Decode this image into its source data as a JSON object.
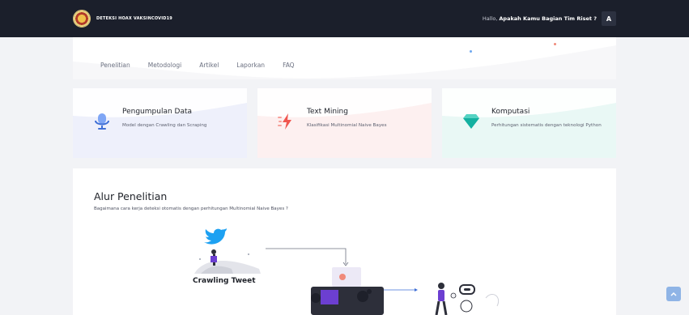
{
  "header": {
    "brand": "DETEKSI HOAX VAKSINCOVID19",
    "greeting": "Hallo,",
    "greeting_name": "Apakah Kamu Bagian Tim Riset ?",
    "avatar_initial": "A"
  },
  "nav": {
    "items": [
      {
        "label": "Penelitian"
      },
      {
        "label": "Metodologi"
      },
      {
        "label": "Artikel"
      },
      {
        "label": "Laporkan"
      },
      {
        "label": "FAQ"
      }
    ]
  },
  "cards": [
    {
      "title": "Pengumpulan Data",
      "desc": "Model dengan Crawling dan Scraping",
      "icon": "microphone-icon",
      "color": "#5b8df0",
      "bg": "#eef0fb"
    },
    {
      "title": "Text Mining",
      "desc": "Klasifikasi Multinomial Naive Bayes",
      "icon": "lightning-icon",
      "color": "#f0564f",
      "bg": "#fdf0f0"
    },
    {
      "title": "Komputasi",
      "desc": "Perhitungan sistematis dengan teknologi Python",
      "icon": "diamond-icon",
      "color": "#18b5a5",
      "bg": "#e9f8f5"
    }
  ],
  "main": {
    "title": "Alur Penelitian",
    "subtitle": "Bagaimana cara kerja deteksi otomatis dengan perhitungan Multinomial Naive Bayes ?",
    "step_label": "Crawling Tweet"
  },
  "colors": {
    "topbar": "#1b1f2b",
    "accent_purple": "#6c3fd1",
    "twitter": "#1da1f2"
  }
}
